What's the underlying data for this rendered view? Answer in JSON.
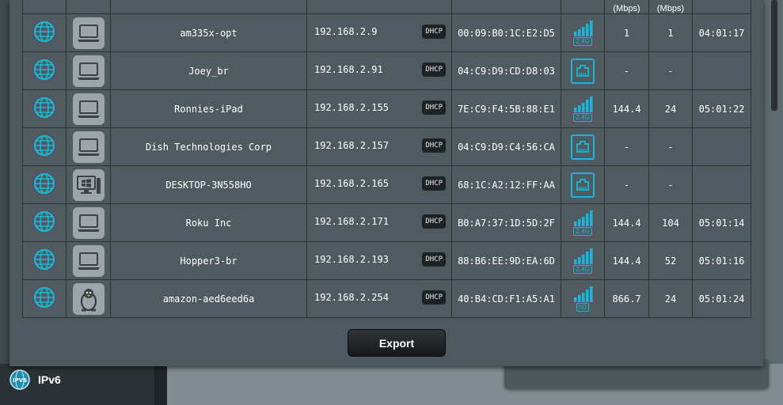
{
  "table": {
    "headers": {
      "tx_rate_unit": "(Mbps)",
      "rx_rate_unit": "(Mbps)"
    },
    "rows": [
      {
        "name": "am335x-opt",
        "ip": "192.168.2.9",
        "ip_mode": "DHCP",
        "mac": "00:09:B0:1C:E2:D5",
        "conn": "wifi",
        "band": "2.4G",
        "tx": "1",
        "rx": "1",
        "time": "04:01:17",
        "device": "laptop"
      },
      {
        "name": "Joey_br",
        "ip": "192.168.2.91",
        "ip_mode": "DHCP",
        "mac": "04:C9:D9:CD:D8:03",
        "conn": "wired",
        "band": "",
        "tx": "-",
        "rx": "-",
        "time": "",
        "device": "laptop"
      },
      {
        "name": "Ronnies-iPad",
        "ip": "192.168.2.155",
        "ip_mode": "DHCP",
        "mac": "7E:C9:F4:5B:88:E1",
        "conn": "wifi",
        "band": "2.4G",
        "tx": "144.4",
        "rx": "24",
        "time": "05:01:22",
        "device": "laptop"
      },
      {
        "name": "Dish Technologies Corp",
        "ip": "192.168.2.157",
        "ip_mode": "DHCP",
        "mac": "04:C9:D9:C4:56:CA",
        "conn": "wired",
        "band": "",
        "tx": "-",
        "rx": "-",
        "time": "",
        "device": "laptop"
      },
      {
        "name": "DESKTOP-3N558HO",
        "ip": "192.168.2.165",
        "ip_mode": "DHCP",
        "mac": "68:1C:A2:12:FF:AA",
        "conn": "wired",
        "band": "",
        "tx": "-",
        "rx": "-",
        "time": "",
        "device": "windows"
      },
      {
        "name": "Roku Inc",
        "ip": "192.168.2.171",
        "ip_mode": "DHCP",
        "mac": "B0:A7:37:1D:5D:2F",
        "conn": "wifi",
        "band": "2.4G",
        "tx": "144.4",
        "rx": "104",
        "time": "05:01:14",
        "device": "laptop"
      },
      {
        "name": "Hopper3-br",
        "ip": "192.168.2.193",
        "ip_mode": "DHCP",
        "mac": "88:B6:EE:9D:EA:6D",
        "conn": "wifi",
        "band": "2.4G",
        "tx": "144.4",
        "rx": "52",
        "time": "05:01:16",
        "device": "laptop"
      },
      {
        "name": "amazon-aed6eed6a",
        "ip": "192.168.2.254",
        "ip_mode": "DHCP",
        "mac": "40:B4:CD:F1:A5:A1",
        "conn": "wifi",
        "band": "5G",
        "tx": "866.7",
        "rx": "24",
        "time": "05:01:24",
        "device": "linux"
      }
    ]
  },
  "export_label": "Export",
  "nav": {
    "ipv6_label": "IPv6",
    "ipv6_icon_text": "IPV6"
  },
  "colors": {
    "accent": "#19b8d8",
    "panel": "#4d595e"
  },
  "icons": {
    "interface": "globe-icon",
    "wifi": "wifi-signal-icon",
    "wired": "ethernet-icon"
  }
}
